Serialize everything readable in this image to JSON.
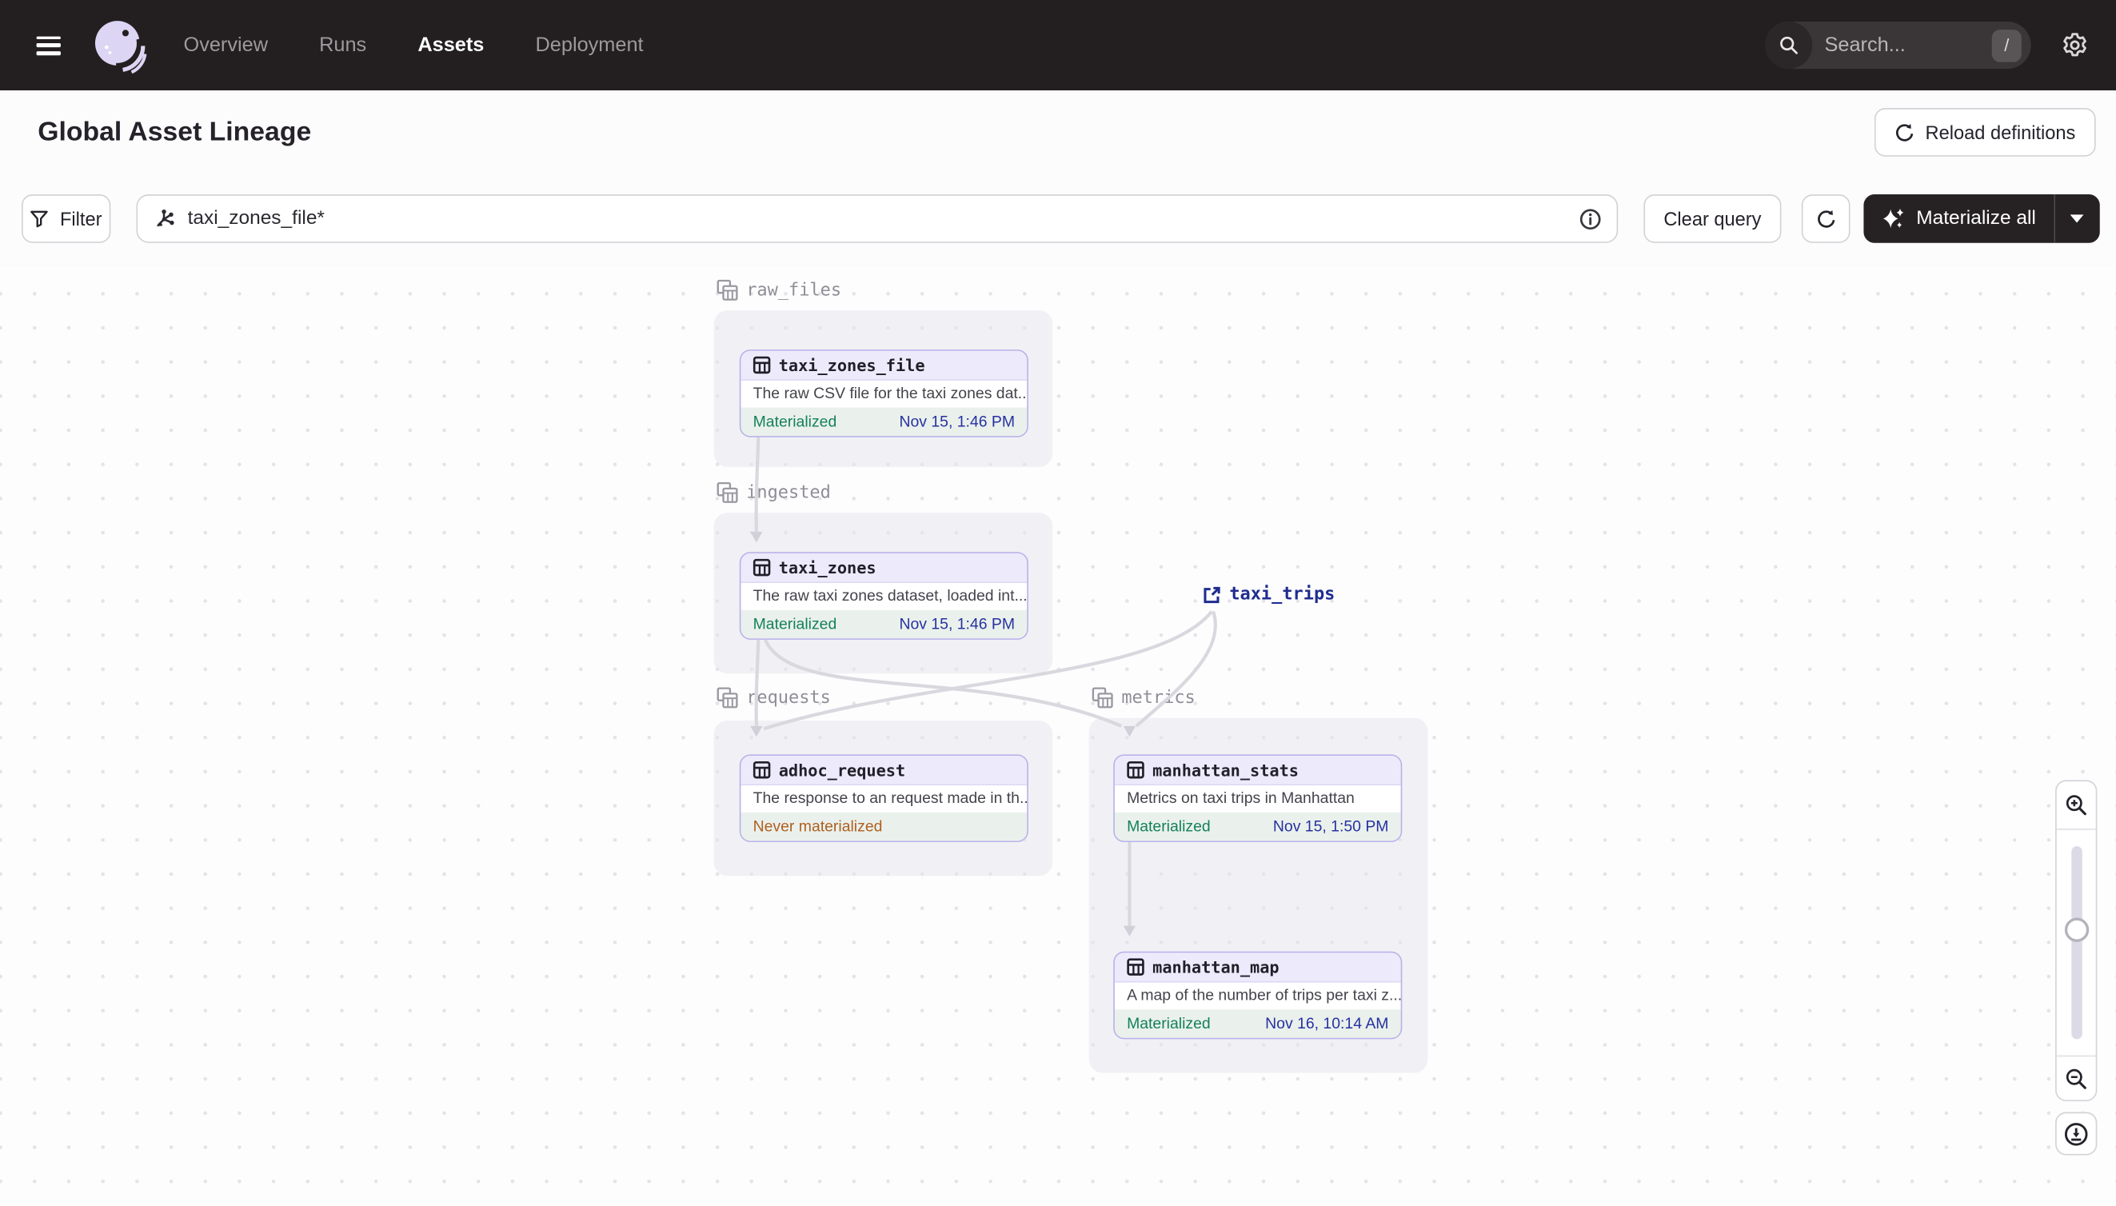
{
  "nav": {
    "items": [
      {
        "label": "Overview",
        "active": false
      },
      {
        "label": "Runs",
        "active": false
      },
      {
        "label": "Assets",
        "active": true
      },
      {
        "label": "Deployment",
        "active": false
      }
    ],
    "search_placeholder": "Search...",
    "search_shortcut": "/"
  },
  "header": {
    "title": "Global Asset Lineage",
    "reload_button": "Reload definitions"
  },
  "toolbar": {
    "filter_button": "Filter",
    "query_value": "taxi_zones_file*",
    "clear_button": "Clear query",
    "materialize_button": "Materialize all"
  },
  "graph": {
    "groups": [
      {
        "name": "raw_files"
      },
      {
        "name": "ingested"
      },
      {
        "name": "requests"
      },
      {
        "name": "metrics"
      }
    ],
    "nodes": [
      {
        "name": "taxi_zones_file",
        "group": "raw_files",
        "description": "The raw CSV file for the taxi zones dat...",
        "status": "Materialized",
        "timestamp": "Nov 15, 1:46 PM"
      },
      {
        "name": "taxi_zones",
        "group": "ingested",
        "description": "The raw taxi zones dataset, loaded int...",
        "status": "Materialized",
        "timestamp": "Nov 15, 1:46 PM"
      },
      {
        "name": "adhoc_request",
        "group": "requests",
        "description": "The response to an request made in th...",
        "status": "Never materialized",
        "timestamp": ""
      },
      {
        "name": "manhattan_stats",
        "group": "metrics",
        "description": "Metrics on taxi trips in Manhattan",
        "status": "Materialized",
        "timestamp": "Nov 15, 1:50 PM"
      },
      {
        "name": "manhattan_map",
        "group": "metrics",
        "description": "A map of the number of trips per taxi z...",
        "status": "Materialized",
        "timestamp": "Nov 16, 10:14 AM"
      }
    ],
    "external_assets": [
      {
        "name": "taxi_trips"
      }
    ]
  },
  "colors": {
    "nav_bg": "#231F20",
    "node_border": "#B9B2EA",
    "node_header_bg": "#EDEBFB",
    "materialized_green": "#15805C",
    "timestamp_blue": "#2731A1",
    "never_materialized_orange": "#AF5F20",
    "external_link_navy": "#1F2D8E",
    "edge_gray": "#DAD8DF"
  }
}
